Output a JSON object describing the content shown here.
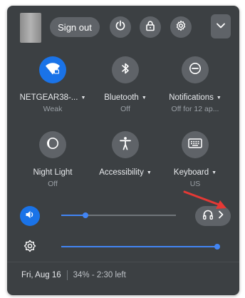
{
  "header": {
    "signout_label": "Sign out"
  },
  "tiles": [
    {
      "label": "NETGEAR38-...",
      "sub": "Weak",
      "icon": "wifi-icon",
      "active": true
    },
    {
      "label": "Bluetooth",
      "sub": "Off",
      "icon": "bluetooth-icon",
      "active": false
    },
    {
      "label": "Notifications",
      "sub": "Off for 12 ap...",
      "icon": "do-not-disturb-icon",
      "active": false
    },
    {
      "label": "Night Light",
      "sub": "Off",
      "icon": "night-light-icon",
      "active": false
    },
    {
      "label": "Accessibility",
      "sub": "",
      "icon": "accessibility-icon",
      "active": false
    },
    {
      "label": "Keyboard",
      "sub": "US",
      "icon": "keyboard-icon",
      "active": false
    }
  ],
  "sliders": {
    "volume_level": 0.21,
    "brightness_level": 1.0
  },
  "footer": {
    "date": "Fri, Aug 16",
    "battery": "34% - 2:30 left"
  },
  "colors": {
    "panel": "#3c4043",
    "button": "#5f6368",
    "accent": "#1a73e8",
    "annotation_arrow": "#e53935"
  }
}
